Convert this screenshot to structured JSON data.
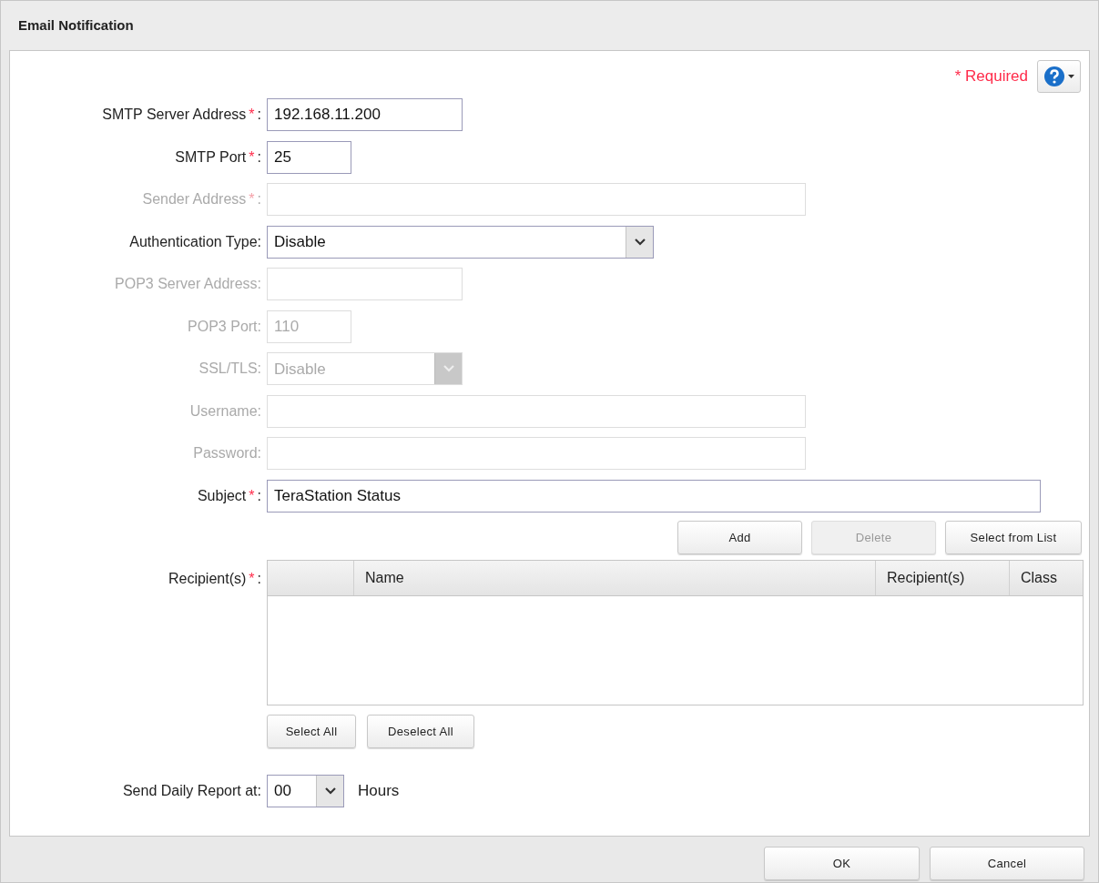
{
  "window": {
    "title": "Email Notification"
  },
  "required_legend": "* Required",
  "fields": [
    {
      "kind": "text",
      "label": "SMTP Server Address",
      "required_mark": "*",
      "separator": ":",
      "value": "192.168.11.200",
      "disabled": false
    },
    {
      "kind": "text",
      "label": "SMTP Port",
      "required_mark": "*",
      "separator": ":",
      "value": "25",
      "disabled": false
    },
    {
      "kind": "text",
      "label": "Sender Address",
      "required_mark": "*",
      "separator": ":",
      "disabled": true
    },
    {
      "kind": "select",
      "label": "Authentication Type:",
      "value": "Disable",
      "disabled": false
    },
    {
      "kind": "text",
      "label": "POP3 Server Address:",
      "disabled": true
    },
    {
      "kind": "text",
      "label": "POP3 Port:",
      "value": "110",
      "disabled": true
    },
    {
      "kind": "select",
      "label": "SSL/TLS:",
      "value": "Disable",
      "disabled": true
    },
    {
      "kind": "text",
      "label": "Username:",
      "disabled": true
    },
    {
      "kind": "text",
      "label": "Password:",
      "disabled": true
    },
    {
      "kind": "text",
      "label": "Subject",
      "required_mark": "*",
      "separator": ":",
      "value": "TeraStation Status",
      "disabled": false
    }
  ],
  "recipient_buttons": [
    {
      "label": "Add",
      "disabled": false
    },
    {
      "label": "Delete",
      "disabled": true
    },
    {
      "label": "Select from List",
      "disabled": false
    }
  ],
  "recipients": {
    "label": "Recipient(s)",
    "required_mark": "*",
    "separator": ":",
    "columns": [
      "Name",
      "Recipient(s)",
      "Class"
    ]
  },
  "selection_buttons": [
    "Select All",
    "Deselect All"
  ],
  "daily_report": {
    "label": "Send Daily Report at:",
    "value": "00",
    "unit": "Hours"
  },
  "footer_buttons": [
    "OK",
    "Cancel"
  ]
}
